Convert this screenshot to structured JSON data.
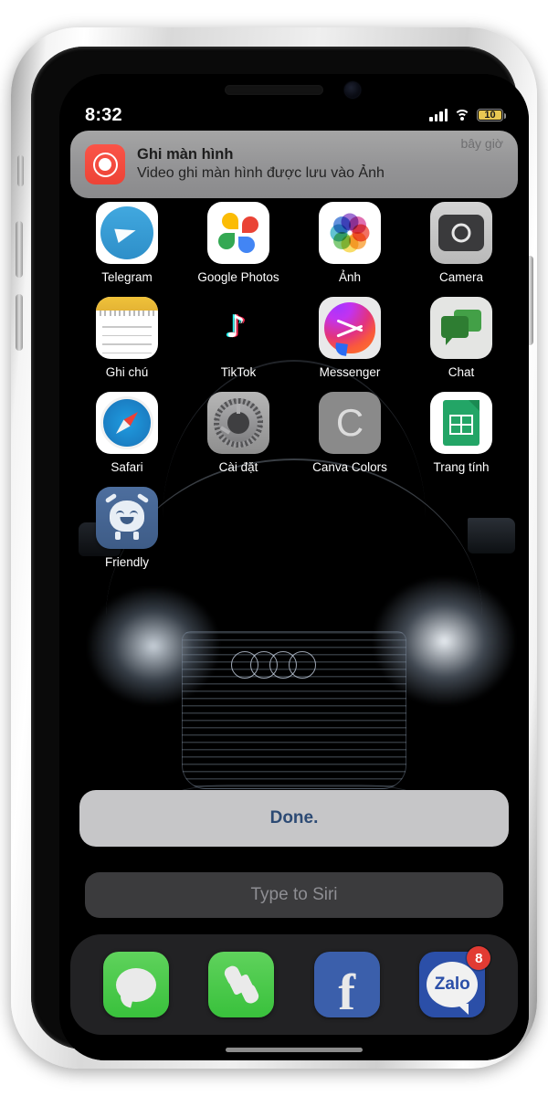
{
  "status_bar": {
    "time": "8:32",
    "battery_percent": "10",
    "signal_icon": "cellular-signal-icon",
    "wifi_icon": "wifi-icon",
    "battery_icon": "battery-icon",
    "battery_color": "#e8c752"
  },
  "notification": {
    "app_icon": "screen-recording-icon",
    "title": "Ghi màn hình",
    "body": "Video ghi màn hình được lưu vào Ảnh",
    "time": "bây giờ"
  },
  "home_screen": {
    "rows": [
      [
        {
          "label": "Telegram",
          "icon": "telegram-icon"
        },
        {
          "label": "Google Photos",
          "icon": "google-photos-icon"
        },
        {
          "label": "Ảnh",
          "icon": "photos-icon"
        },
        {
          "label": "Camera",
          "icon": "camera-icon"
        }
      ],
      [
        {
          "label": "Ghi chú",
          "icon": "notes-icon"
        },
        {
          "label": "TikTok",
          "icon": "tiktok-icon"
        },
        {
          "label": "Messenger",
          "icon": "messenger-icon"
        },
        {
          "label": "Chat",
          "icon": "google-chat-icon"
        }
      ],
      [
        {
          "label": "Safari",
          "icon": "safari-icon"
        },
        {
          "label": "Cài đặt",
          "icon": "settings-icon"
        },
        {
          "label": "Canva Colors",
          "icon": "canva-colors-icon"
        },
        {
          "label": "Trang tính",
          "icon": "google-sheets-icon"
        }
      ],
      [
        {
          "label": "Friendly",
          "icon": "friendly-icon"
        }
      ]
    ]
  },
  "siri": {
    "answer": "Done.",
    "answer_color": "#2c4a74",
    "input_placeholder": "Type to Siri"
  },
  "dock": {
    "apps": [
      {
        "label": "Messages",
        "icon": "messages-icon",
        "badge": ""
      },
      {
        "label": "Phone",
        "icon": "phone-icon",
        "badge": ""
      },
      {
        "label": "Facebook",
        "icon": "facebook-icon",
        "glyph": "f",
        "badge": ""
      },
      {
        "label": "Zalo",
        "icon": "zalo-icon",
        "glyph": "Zalo",
        "badge": "8"
      }
    ]
  },
  "hardware": {
    "mute_switch": "mute-switch",
    "volume_up": "volume-up-button",
    "volume_down": "volume-down-button",
    "power": "power-button",
    "speaker": "earpiece-speaker",
    "front_camera": "front-camera"
  }
}
